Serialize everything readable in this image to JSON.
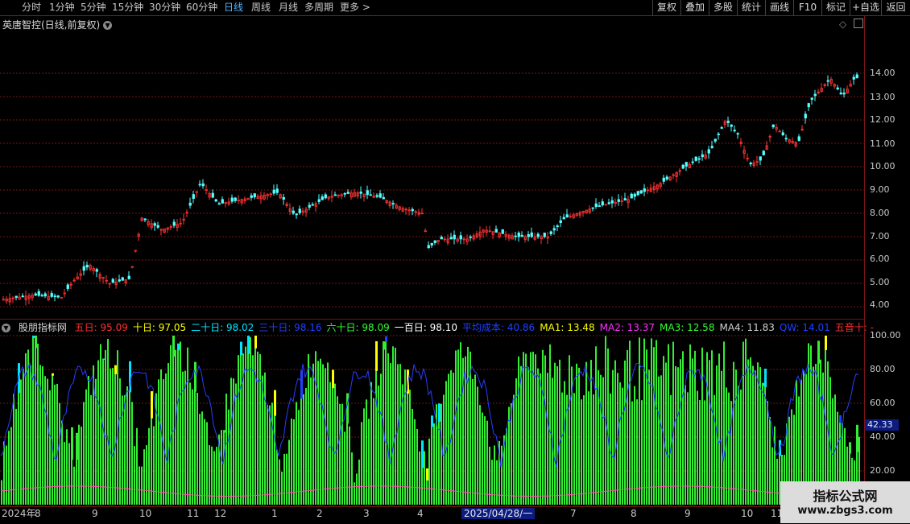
{
  "toolbar": {
    "periods": [
      "分时",
      "1分钟",
      "5分钟",
      "15分钟",
      "30分钟",
      "60分钟",
      "日线",
      "周线",
      "月线",
      "多周期",
      "更多 >"
    ],
    "active_period": "日线",
    "right_buttons": [
      "复权",
      "叠加",
      "多股",
      "统计",
      "画线",
      "F10",
      "标记",
      "+自选",
      "返回"
    ]
  },
  "stock": {
    "title": "英唐智控(日线,前复权)"
  },
  "price_axis": {
    "labels": [
      "14.00",
      "13.00",
      "12.00",
      "11.00",
      "10.00",
      "9.00",
      "8.00",
      "7.00",
      "6.00",
      "5.00",
      "4.00"
    ],
    "values": [
      14,
      13,
      12,
      11,
      10,
      9,
      8,
      7,
      6,
      5,
      4
    ]
  },
  "indicator": {
    "name": "股朋指标网",
    "items": [
      {
        "text": "五日: 95.09",
        "color": "#ff3030"
      },
      {
        "text": "十日: 97.05",
        "color": "#ffff00"
      },
      {
        "text": "二十日: 98.02",
        "color": "#00e5ff"
      },
      {
        "text": "三十日: 98.16",
        "color": "#2040ff"
      },
      {
        "text": "六十日: 98.09",
        "color": "#33ff33"
      },
      {
        "text": "一百日: 98.10",
        "color": "#ffffff"
      },
      {
        "text": "平均成本: 40.86",
        "color": "#2040ff"
      },
      {
        "text": "MA1: 13.48",
        "color": "#ffff00"
      },
      {
        "text": "MA2: 13.37",
        "color": "#ff30ff"
      },
      {
        "text": "MA3: 12.58",
        "color": "#33ff33"
      },
      {
        "text": "MA4: 11.83",
        "color": "#d0d0d0"
      },
      {
        "text": "QW: 14.01",
        "color": "#2040ff"
      },
      {
        "text": "五音十: -",
        "color": "#ff3030"
      }
    ],
    "axis_labels": [
      "100.00",
      "80.00",
      "60.00",
      "40.00",
      "20.00"
    ],
    "axis_values": [
      100,
      80,
      60,
      40,
      20
    ],
    "current_value": "42.33"
  },
  "time_axis": {
    "labels": [
      "2024年",
      "8",
      "9",
      "10",
      "11",
      "12",
      "1",
      "2",
      "3",
      "4",
      "7",
      "8",
      "9",
      "10",
      "11"
    ],
    "highlight": "2025/04/28/一"
  },
  "watermark": {
    "title": "指标公式网",
    "url": "www.zbgs3.com"
  },
  "colors": {
    "up": "#ff3333",
    "down": "#54ffff",
    "grid": "#7a1515",
    "bar_green": "#33ee33"
  }
}
